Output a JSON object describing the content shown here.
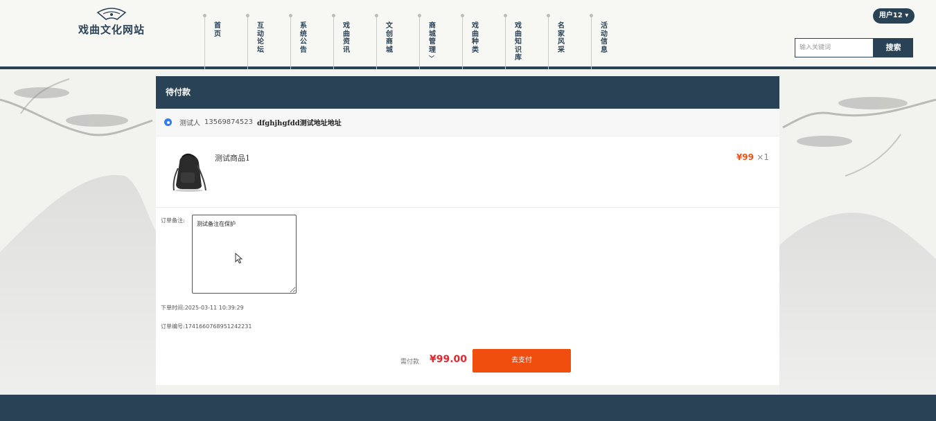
{
  "site": {
    "name": "戏曲文化网站"
  },
  "nav": [
    {
      "label": "首页",
      "has_dropdown": false
    },
    {
      "label": "互动论坛",
      "has_dropdown": false
    },
    {
      "label": "系统公告",
      "has_dropdown": false
    },
    {
      "label": "戏曲资讯",
      "has_dropdown": false
    },
    {
      "label": "文创商城",
      "has_dropdown": false
    },
    {
      "label": "商城管理",
      "has_dropdown": true
    },
    {
      "label": "戏曲种类",
      "has_dropdown": false
    },
    {
      "label": "戏曲知识库",
      "has_dropdown": false
    },
    {
      "label": "名家风采",
      "has_dropdown": false
    },
    {
      "label": "活动信息",
      "has_dropdown": false
    }
  ],
  "user": {
    "label": "用户12",
    "caret": "▾"
  },
  "search": {
    "placeholder": "输入关键词",
    "button": "搜索"
  },
  "order": {
    "status_title": "待付款",
    "address": {
      "name": "测试人",
      "phone": "13569874523",
      "detail": "dfghjhgfdd测试地址地址"
    },
    "goods": [
      {
        "name": "测试商品1",
        "price": "¥99",
        "qty": "×1",
        "image_icon": "backpack-icon"
      }
    ],
    "remark_label": "订单备注:",
    "remark_value": "测试备注在保护",
    "order_time_label": "下单时间:",
    "order_time": "2025-03-11 10:39:29",
    "order_no_label": "订单编号:",
    "order_no": "1741660768951242231",
    "pay_label": "需付款",
    "pay_amount": "¥99.00",
    "pay_button": "去支付"
  },
  "colors": {
    "primary": "#2a4256",
    "accent": "#f04e0e",
    "price": "#e8531c",
    "total": "#e8262a",
    "pin": "#2f7cf6"
  }
}
